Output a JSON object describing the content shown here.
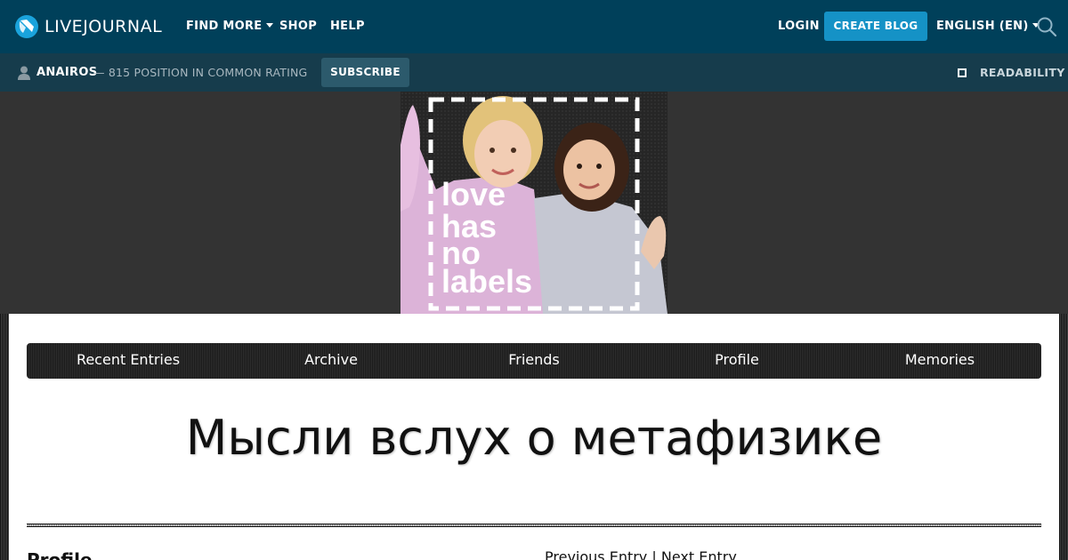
{
  "topbar": {
    "logo_text": "LIVEJOURNAL",
    "find_more": "FIND MORE",
    "shop": "SHOP",
    "help": "HELP",
    "login": "LOGIN",
    "create_blog": "CREATE BLOG",
    "language": "ENGLISH (EN)"
  },
  "journal_bar": {
    "username": "ANAIROS",
    "rating_text": "— 815 POSITION IN COMMON RATING",
    "subscribe": "SUBSCRIBE",
    "readability": "READABILITY"
  },
  "banner": {
    "words": [
      "love",
      "has",
      "no",
      "labels"
    ]
  },
  "journal_nav": {
    "items": [
      "Recent Entries",
      "Archive",
      "Friends",
      "Profile",
      "Memories"
    ]
  },
  "journal": {
    "title": "Мысли вслух о метафизике"
  },
  "sidebar": {
    "profile_heading": "Profile"
  },
  "entry_nav": {
    "previous": "Previous Entry",
    "separator": "|",
    "next": "Next Entry"
  },
  "colors": {
    "topbar_bg": "#00405a",
    "journal_bar_bg": "#163c4c",
    "accent_button": "#1592c6",
    "page_bg": "#333333"
  },
  "icons": [
    "livejournal-logo-icon",
    "caret-down-icon",
    "search-icon",
    "user-icon",
    "checkbox-icon"
  ]
}
